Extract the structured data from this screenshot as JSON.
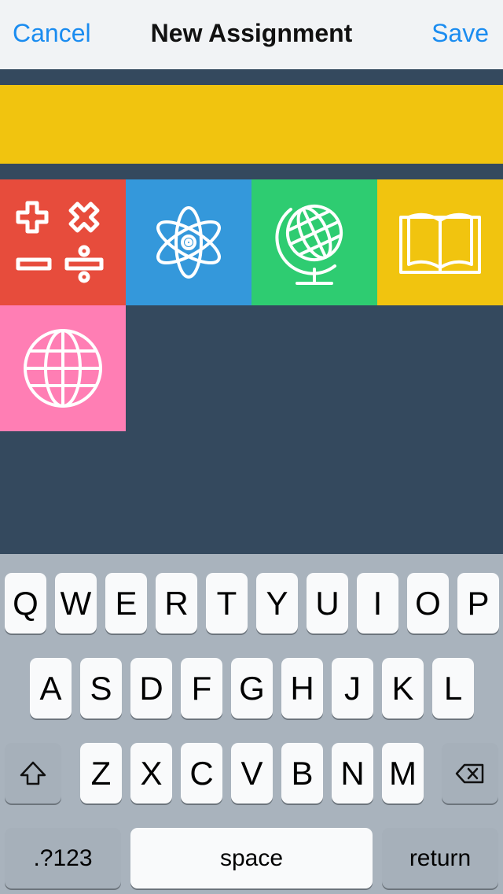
{
  "nav": {
    "cancel": "Cancel",
    "title": "New Assignment",
    "save": "Save"
  },
  "selected_color": "#f1c40f",
  "subjects": [
    {
      "icon": "math-operators-icon",
      "color": "#e74c3c"
    },
    {
      "icon": "atom-icon",
      "color": "#3498db"
    },
    {
      "icon": "desk-globe-icon",
      "color": "#2ecc71"
    },
    {
      "icon": "open-book-icon",
      "color": "#f1c40f"
    },
    {
      "icon": "globe-icon",
      "color": "#ff7eb4"
    }
  ],
  "keyboard": {
    "row1": [
      "Q",
      "W",
      "E",
      "R",
      "T",
      "Y",
      "U",
      "I",
      "O",
      "P"
    ],
    "row2": [
      "A",
      "S",
      "D",
      "F",
      "G",
      "H",
      "J",
      "K",
      "L"
    ],
    "row3": [
      "Z",
      "X",
      "C",
      "V",
      "B",
      "N",
      "M"
    ],
    "shift_icon": "shift-icon",
    "delete_icon": "backspace-icon",
    "numbers": ".?123",
    "space": "space",
    "return": "return"
  }
}
